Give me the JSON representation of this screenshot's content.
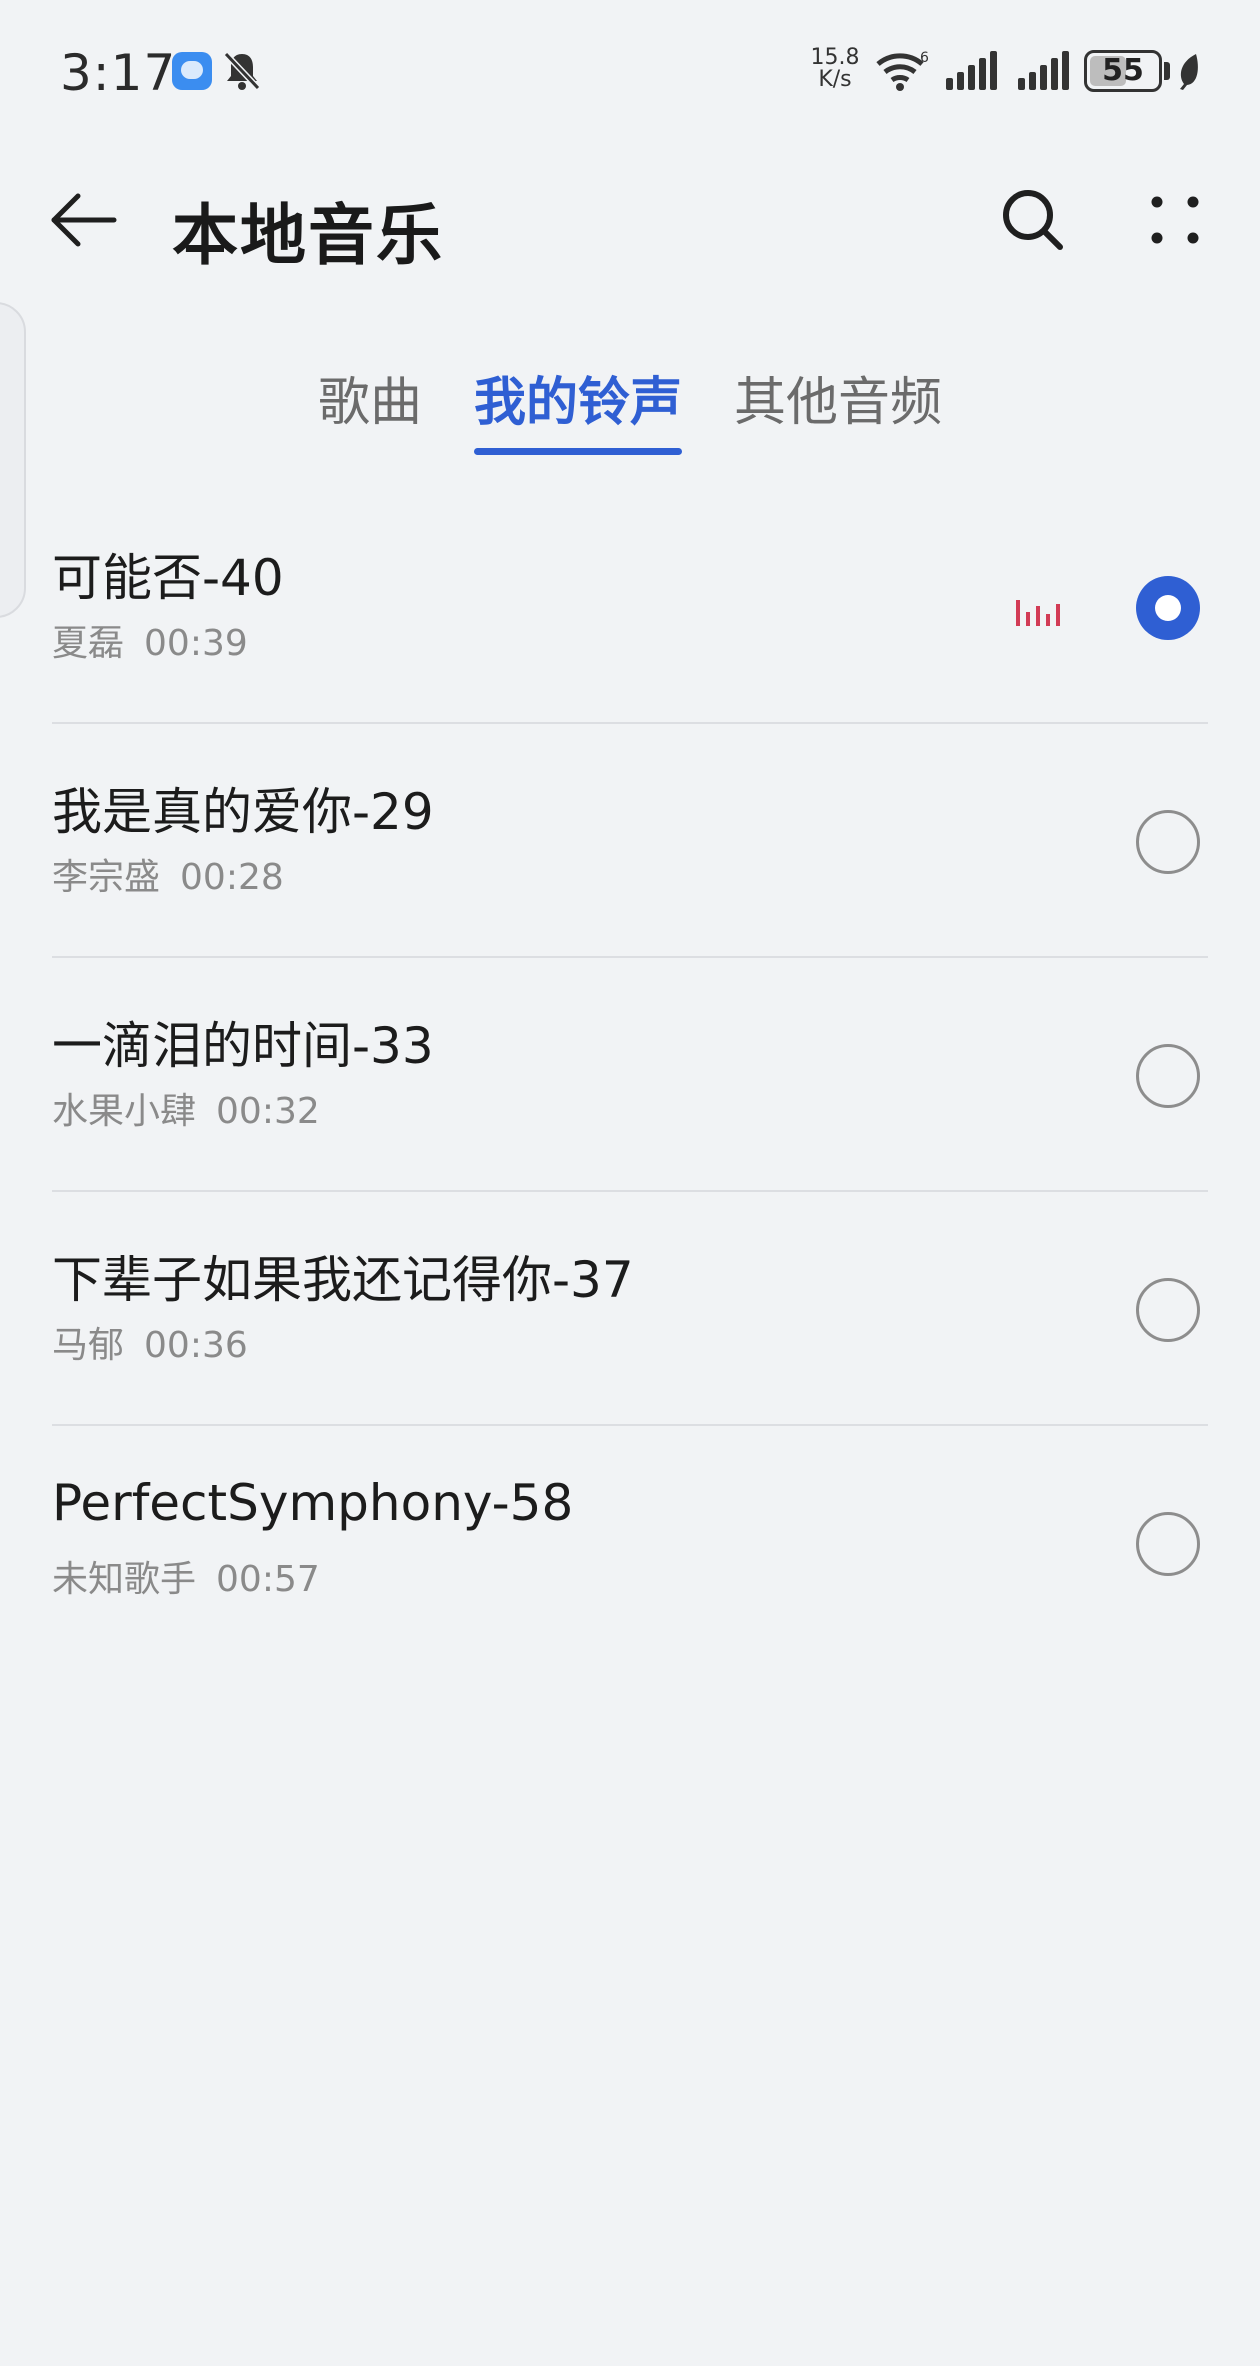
{
  "status_bar": {
    "time": "3:17",
    "net_speed_value": "15.8",
    "net_speed_unit": "K/s",
    "wifi_badge": "6",
    "battery_level": "55",
    "icons": [
      "message-icon",
      "bell-off-icon",
      "wifi-icon",
      "signal-icon",
      "signal-icon",
      "battery-icon",
      "leaf-icon"
    ]
  },
  "header": {
    "title": "本地音乐",
    "back_icon": "back-arrow-icon",
    "search_icon": "search-icon",
    "more_icon": "more-dots-icon"
  },
  "tabs": [
    {
      "label": "歌曲",
      "active": false
    },
    {
      "label": "我的铃声",
      "active": true
    },
    {
      "label": "其他音频",
      "active": false
    }
  ],
  "ringtones": [
    {
      "title": "可能否-40",
      "artist": "夏磊",
      "duration": "00:39",
      "selected": true,
      "playing": true
    },
    {
      "title": "我是真的爱你-29",
      "artist": "李宗盛",
      "duration": "00:28",
      "selected": false,
      "playing": false
    },
    {
      "title": "一滴泪的时间-33",
      "artist": "水果小肆",
      "duration": "00:32",
      "selected": false,
      "playing": false
    },
    {
      "title": "下辈子如果我还记得你-37",
      "artist": "马郁",
      "duration": "00:36",
      "selected": false,
      "playing": false
    },
    {
      "title": "PerfectSymphony-58",
      "artist": "未知歌手",
      "duration": "00:57",
      "selected": false,
      "playing": false
    }
  ],
  "colors": {
    "accent": "#2f5fd3",
    "playing_indicator": "#d23b55",
    "background": "#f1f3f5"
  }
}
